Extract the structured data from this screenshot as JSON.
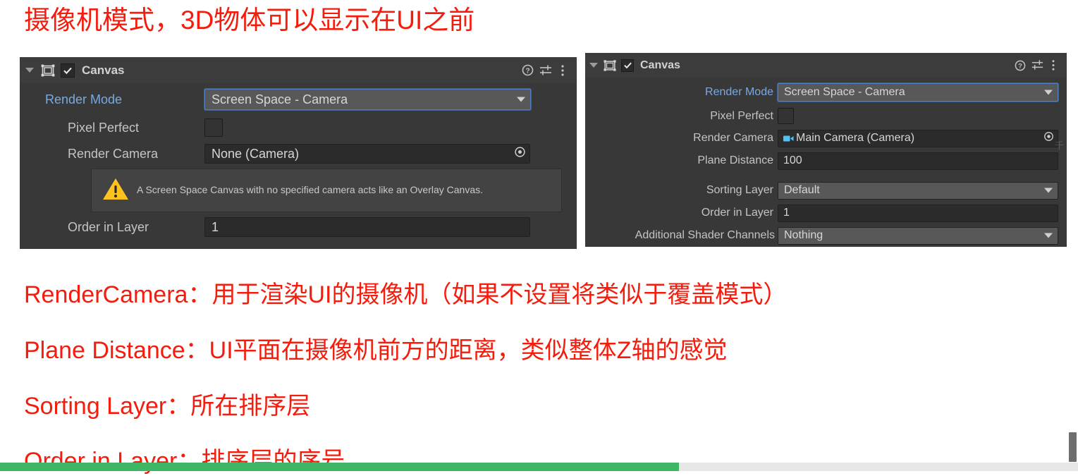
{
  "heading": "摄像机模式，3D物体可以显示在UI之前",
  "accent_color": "#f41c0c",
  "panels": {
    "left": {
      "header": {
        "title": "Canvas",
        "enabled_check": "✔",
        "icons": {
          "help": "help-icon",
          "preset": "preset-icon",
          "menu": "more-menu-icon"
        }
      },
      "rows": {
        "render_mode": {
          "label": "Render Mode",
          "value": "Screen Space - Camera"
        },
        "pixel_perfect": {
          "label": "Pixel Perfect",
          "checked": false
        },
        "render_camera": {
          "label": "Render Camera",
          "value": "None (Camera)"
        },
        "order_in_layer": {
          "label": "Order in Layer",
          "value": "1"
        }
      },
      "warning": {
        "icon": "warning-triangle-icon",
        "text": "A Screen Space Canvas with no specified camera acts like an Overlay Canvas."
      }
    },
    "right": {
      "header": {
        "title": "Canvas",
        "enabled_check": "✔",
        "icons": {
          "help": "help-icon",
          "preset": "preset-icon",
          "menu": "more-menu-icon"
        }
      },
      "rows": {
        "render_mode": {
          "label": "Render Mode",
          "value": "Screen Space - Camera"
        },
        "pixel_perfect": {
          "label": "Pixel Perfect",
          "checked": false
        },
        "render_camera": {
          "label": "Render Camera",
          "value": "Main Camera (Camera)"
        },
        "plane_distance": {
          "label": "Plane Distance",
          "value": "100"
        },
        "sorting_layer": {
          "label": "Sorting Layer",
          "value": "Default"
        },
        "order_in_layer": {
          "label": "Order in Layer",
          "value": "1"
        },
        "additional_shader_channels": {
          "label": "Additional Shader Channels",
          "value": "Nothing"
        }
      }
    }
  },
  "notes": [
    "RenderCamera：用于渲染UI的摄像机（如果不设置将类似于覆盖模式）",
    "Plane Distance：UI平面在摄像机前方的距离，类似整体Z轴的感觉",
    "Sorting Layer：所在排序层",
    "Order in Layer：排序层的序号"
  ],
  "progress": {
    "percent": 63,
    "fill_color": "#3fb664",
    "track_color": "#e6e6e6"
  }
}
